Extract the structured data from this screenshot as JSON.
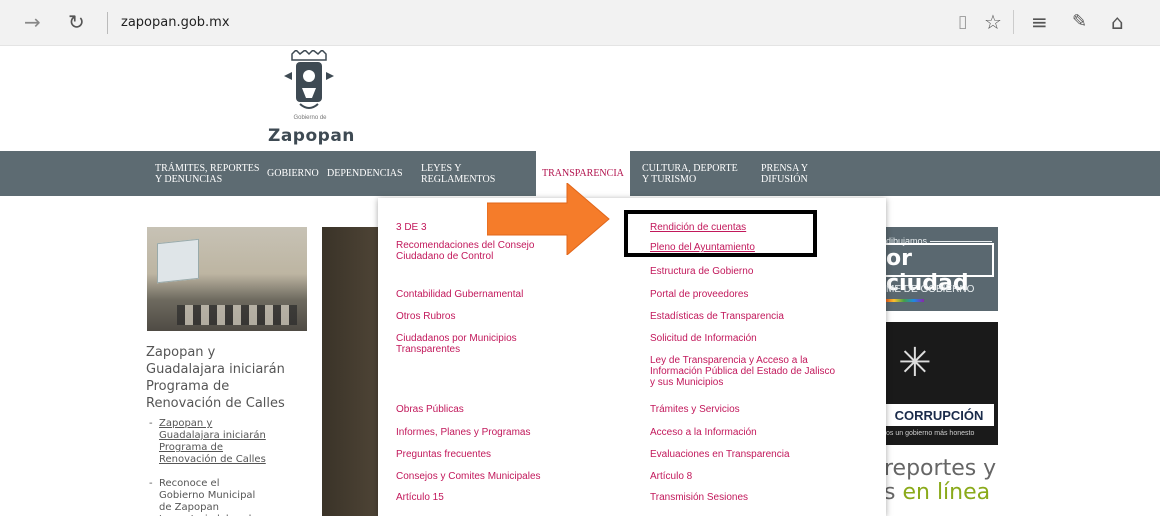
{
  "browser": {
    "url": "zapopan.gob.mx",
    "icons": [
      "forward-icon",
      "refresh-icon",
      "reading-view-icon",
      "favorites-star-icon",
      "hub-icon",
      "web-note-icon",
      "share-icon"
    ]
  },
  "logo": {
    "caption": "Gobierno de",
    "name": "Zapopan"
  },
  "nav": {
    "items": [
      {
        "label": "TRÁMITES, REPORTES\nY DENUNCIAS"
      },
      {
        "label": "GOBIERNO"
      },
      {
        "label": "DEPENDENCIAS"
      },
      {
        "label": "LEYES Y\nREGLAMENTOS"
      },
      {
        "label": "TRANSPARENCIA"
      },
      {
        "label": "CULTURA, DEPORTE\nY TURISMO"
      },
      {
        "label": "PRENSA Y\nDIFUSIÓN"
      }
    ]
  },
  "dropdown": {
    "left": [
      "3 DE 3",
      "Recomendaciones del Consejo\nCiudadano de Control",
      "Contabilidad Gubernamental",
      "Otros Rubros",
      "Ciudadanos por Municipios\nTransparentes",
      "Obras Públicas",
      "Informes, Planes y Programas",
      "Preguntas frecuentes",
      "Consejos y Comites Municipales",
      "Artículo 15"
    ],
    "right": [
      "Rendición de cuentas",
      "Pleno del Ayuntamiento",
      "Estructura de Gobierno",
      "Portal de proveedores",
      "Estadísticas de Transparencia",
      "Solicitud de Información",
      "Ley de Transparencia y Acceso a la\nInformación Pública del Estado de Jalisco\ny sus Municipios",
      "Trámites y Servicios",
      "Acceso a la Información",
      "Evaluaciones en Transparencia",
      "Artículo 8",
      "Transmisión Sesiones"
    ]
  },
  "news": {
    "title": "Zapopan y Guadalajara iniciarán Programa de Renovación de Calles",
    "links": [
      "Zapopan y Guadalajara iniciarán Programa de Renovación de Calles",
      "Reconoce el Gobierno Municipal de Zapopan trayectoria laboral de"
    ]
  },
  "banners": {
    "b1_top": "dibujamos",
    "b1_main": "or ciudad",
    "b1_sub": "ME DE GOBIERNO",
    "b2_word": "CORRUPCIÓN",
    "b2_sub": "os un gobierno más honesto",
    "b3_line1": "reportes y",
    "b3_prefix": "s",
    "b3_line2": "en línea"
  },
  "colors": {
    "nav_bg": "#5d6b72",
    "accent": "#c2185b",
    "arrow": "#f57c2a"
  }
}
